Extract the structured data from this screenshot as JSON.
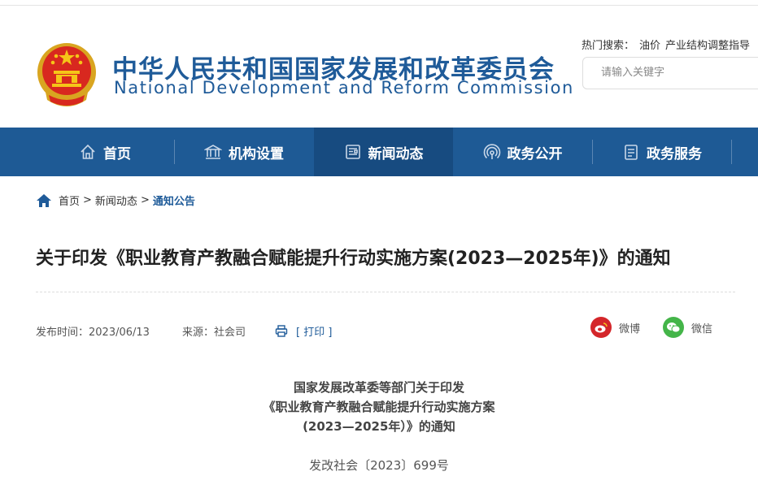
{
  "header": {
    "title_cn": "中华人民共和国国家发展和改革委员会",
    "title_en": "National Development and Reform Commission",
    "hot_label": "热门搜索：",
    "hot_terms": [
      "油价",
      "产业结构调整指导"
    ],
    "search_placeholder": "请输入关键字"
  },
  "nav": {
    "items": [
      {
        "label": "首页",
        "icon": "home-icon"
      },
      {
        "label": "机构设置",
        "icon": "institution-icon"
      },
      {
        "label": "新闻动态",
        "icon": "news-icon",
        "active": true
      },
      {
        "label": "政务公开",
        "icon": "broadcast-icon"
      },
      {
        "label": "政务服务",
        "icon": "service-icon"
      }
    ],
    "colors": {
      "bar": "#1e5a95",
      "active": "#174b80"
    }
  },
  "breadcrumb": {
    "items": [
      "首页",
      "新闻动态",
      "通知公告"
    ],
    "separator": ">"
  },
  "article": {
    "title": "关于印发《职业教育产教融合赋能提升行动实施方案(2023—2025年)》的通知",
    "publish_label": "发布时间：2023/06/13",
    "source_label": "来源：社会司",
    "print_label": "[ 打印 ]",
    "share": [
      {
        "label": "微博",
        "icon": "weibo-icon",
        "color": "#d4262a"
      },
      {
        "label": "微信",
        "icon": "wechat-icon",
        "color": "#44b549"
      }
    ],
    "body_heading": [
      "国家发展改革委等部门关于印发",
      "《职业教育产教融合赋能提升行动实施方案",
      "(2023—2025年）》的通知"
    ],
    "doc_number": "发改社会〔2023〕699号"
  }
}
